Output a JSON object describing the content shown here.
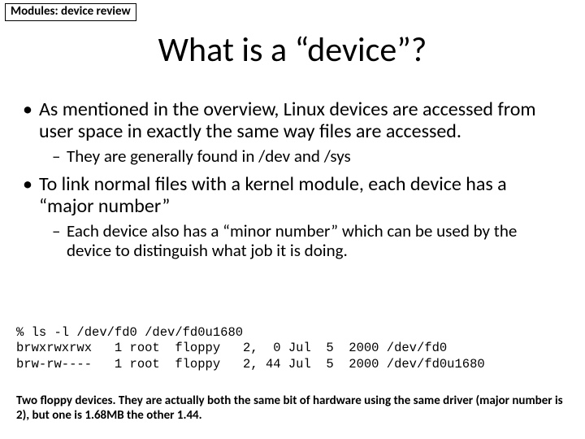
{
  "tag": "Modules: device review",
  "title": "What is a “device”?",
  "bullets": {
    "b1": "As mentioned in the overview, Linux devices are accessed from user space in exactly the same way files are accessed.",
    "b1a": "They are generally found in /dev and /sys",
    "b2": "To link normal files with a kernel module, each device has a “major number”",
    "b2a": "Each device also has a “minor number” which can be used by the device to distinguish what job it is doing."
  },
  "code": {
    "l1": "% ls -l /dev/fd0 /dev/fd0u1680",
    "l2": "brwxrwxrwx   1 root  floppy   2,  0 Jul  5  2000 /dev/fd0",
    "l3": "brw-rw----   1 root  floppy   2, 44 Jul  5  2000 /dev/fd0u1680"
  },
  "caption": "Two floppy devices.  They are actually both the same bit of hardware using the same driver (major number is 2), but one is 1.68MB the other 1.44."
}
